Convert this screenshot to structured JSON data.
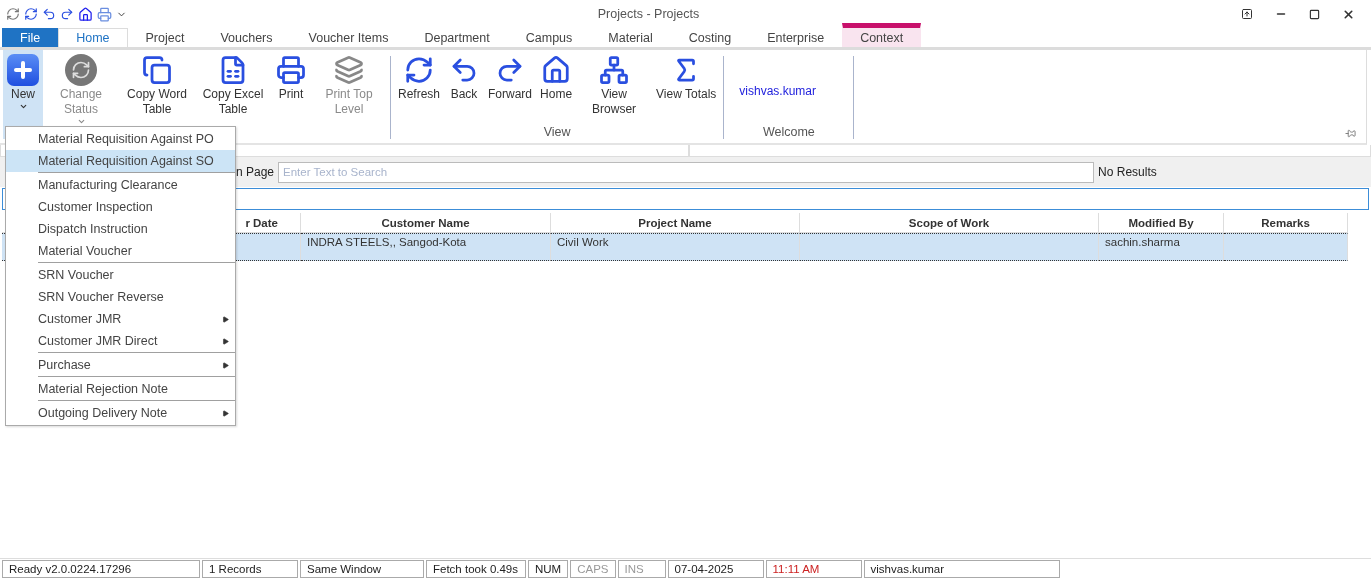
{
  "window": {
    "title": "Projects - Projects"
  },
  "tabs": [
    {
      "label": "File",
      "kind": "file",
      "selected": false
    },
    {
      "label": "Home",
      "kind": "tab",
      "selected": true
    },
    {
      "label": "Project",
      "kind": "tab",
      "selected": false
    },
    {
      "label": "Vouchers",
      "kind": "tab",
      "selected": false
    },
    {
      "label": "Voucher Items",
      "kind": "tab",
      "selected": false
    },
    {
      "label": "Department",
      "kind": "tab",
      "selected": false
    },
    {
      "label": "Campus",
      "kind": "tab",
      "selected": false
    },
    {
      "label": "Material",
      "kind": "tab",
      "selected": false
    },
    {
      "label": "Costing",
      "kind": "tab",
      "selected": false
    },
    {
      "label": "Enterprise",
      "kind": "tab",
      "selected": false
    },
    {
      "label": "Context",
      "kind": "context",
      "selected": false
    }
  ],
  "ribbon": {
    "groups": [
      {
        "buttons": [
          {
            "label": "New",
            "dropdown": true,
            "disabled": false,
            "selected": true
          },
          {
            "label": "Change Status",
            "dropdown": true,
            "disabled": true,
            "selected": false
          },
          {
            "label": "Copy Word Table",
            "dropdown": false,
            "disabled": false,
            "selected": false
          },
          {
            "label": "Copy Excel Table",
            "dropdown": false,
            "disabled": false,
            "selected": false
          },
          {
            "label": "Print",
            "dropdown": false,
            "disabled": false,
            "selected": false
          },
          {
            "label": "Print Top Level",
            "dropdown": false,
            "disabled": true,
            "selected": false
          }
        ]
      },
      {
        "label": "View",
        "buttons": [
          {
            "label": "Refresh",
            "dropdown": false,
            "disabled": false,
            "selected": false
          },
          {
            "label": "Back",
            "dropdown": false,
            "disabled": false,
            "selected": false
          },
          {
            "label": "Forward",
            "dropdown": false,
            "disabled": false,
            "selected": false
          },
          {
            "label": "Home",
            "dropdown": false,
            "disabled": false,
            "selected": false
          },
          {
            "label": "View Browser",
            "dropdown": false,
            "disabled": false,
            "selected": false
          },
          {
            "label": "View Totals",
            "dropdown": false,
            "disabled": false,
            "selected": false
          }
        ]
      },
      {
        "label": "Welcome",
        "user": "vishvas.kumar"
      }
    ]
  },
  "menu": {
    "sections": [
      [
        {
          "label": "Material Requisition Against PO",
          "selected": false,
          "submenu": false
        },
        {
          "label": "Material Requisition Against SO",
          "selected": true,
          "submenu": false
        }
      ],
      [
        {
          "label": "Manufacturing Clearance",
          "selected": false,
          "submenu": false
        },
        {
          "label": "Customer Inspection",
          "selected": false,
          "submenu": false
        },
        {
          "label": "Dispatch Instruction",
          "selected": false,
          "submenu": false
        },
        {
          "label": "Material Voucher",
          "selected": false,
          "submenu": false
        }
      ],
      [
        {
          "label": "SRN Voucher",
          "selected": false,
          "submenu": false
        },
        {
          "label": "SRN Voucher Reverse",
          "selected": false,
          "submenu": false
        },
        {
          "label": "Customer JMR",
          "selected": false,
          "submenu": true
        },
        {
          "label": "Customer JMR Direct",
          "selected": false,
          "submenu": true
        }
      ],
      [
        {
          "label": "Purchase",
          "selected": false,
          "submenu": true
        }
      ],
      [
        {
          "label": "Material Rejection Note",
          "selected": false,
          "submenu": false
        }
      ],
      [
        {
          "label": "Outgoing Delivery Note",
          "selected": false,
          "submenu": true
        }
      ]
    ]
  },
  "search": {
    "label": "n Page",
    "placeholder": "Enter Text to Search",
    "result": "No Results"
  },
  "table": {
    "columns": [
      "r Date",
      "Customer Name",
      "Project Name",
      "Scope of Work",
      "Modified By",
      "Remarks"
    ],
    "rows": [
      {
        "selected": true,
        "customer_name": "INDRA STEELS,, Sangod-Kota",
        "project_name": "Civil Work",
        "modified_by": "sachin.sharma"
      }
    ]
  },
  "status_bar": [
    {
      "text": "Ready v2.0.0224.17296",
      "disabled": false,
      "highlight": false
    },
    {
      "text": "1 Records",
      "disabled": false,
      "highlight": false
    },
    {
      "text": "Same Window",
      "disabled": false,
      "highlight": false
    },
    {
      "text": "Fetch took 0.49s",
      "disabled": false,
      "highlight": false
    },
    {
      "text": "NUM",
      "disabled": false,
      "highlight": false
    },
    {
      "text": "CAPS",
      "disabled": true,
      "highlight": false
    },
    {
      "text": "INS",
      "disabled": true,
      "highlight": false
    },
    {
      "text": "07-04-2025",
      "disabled": false,
      "highlight": false
    },
    {
      "text": "11:11 AM",
      "disabled": false,
      "highlight": true
    },
    {
      "text": "vishvas.kumar",
      "disabled": false,
      "highlight": false
    }
  ]
}
